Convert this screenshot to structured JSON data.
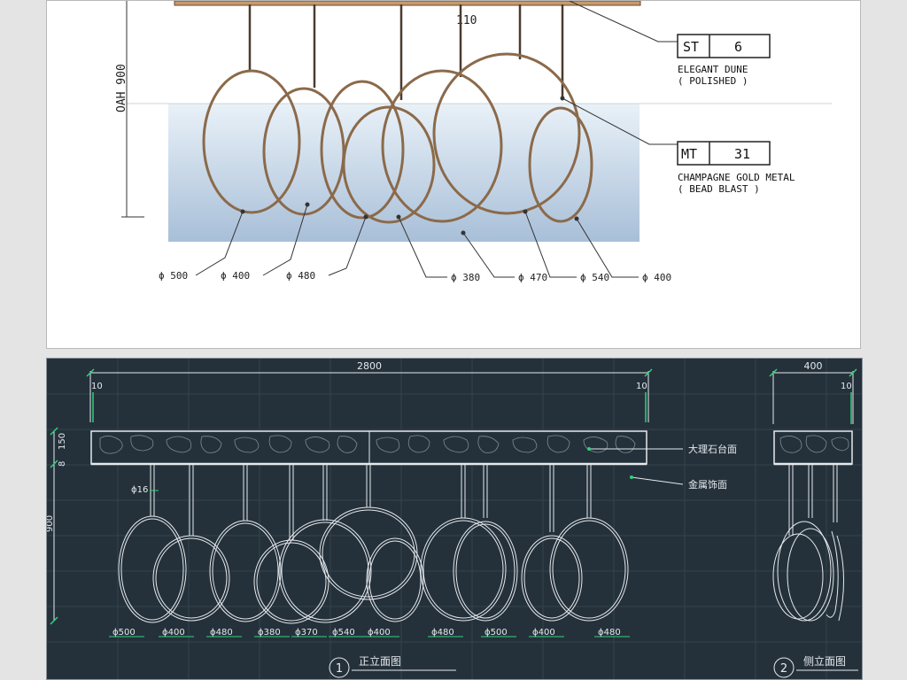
{
  "sketch": {
    "dim_top": "110",
    "dim_height": "OAH 900",
    "tag_stone": {
      "code": "ST",
      "num": "6",
      "name": "ELEGANT DUNE",
      "finish": "( POLISHED )"
    },
    "tag_metal": {
      "code": "MT",
      "num": "31",
      "name": "CHAMPAGNE GOLD METAL",
      "finish": "( BEAD BLAST )"
    },
    "callouts": [
      "ϕ 500",
      "ϕ 400",
      "ϕ 480",
      "ϕ 380",
      "ϕ 470",
      "ϕ 540",
      "ϕ 400"
    ]
  },
  "front_elevation": {
    "width_dim": "2800",
    "left_small_dim": "10",
    "right_small_dim": "10",
    "slab_dims": [
      "8",
      "150"
    ],
    "height_dim": "900",
    "rod_dim": "ϕ16",
    "material_labels": [
      "大理石台面",
      "金属饰面"
    ],
    "ring_labels": [
      "ϕ500",
      "ϕ400",
      "ϕ480",
      "ϕ380",
      "ϕ370",
      "ϕ540",
      "ϕ400",
      "ϕ480",
      "ϕ500",
      "ϕ400",
      "ϕ480"
    ],
    "title_num": "1",
    "title": "正立面图"
  },
  "side_elevation": {
    "width_dim": "400",
    "small_dim": "10",
    "title_num": "2",
    "title": "侧立面图"
  },
  "colors": {
    "cad_bg": "#24313b",
    "cad_line": "#e6e9ec",
    "cad_dim": "#2fd27a",
    "metal": "#8b6a4a"
  }
}
